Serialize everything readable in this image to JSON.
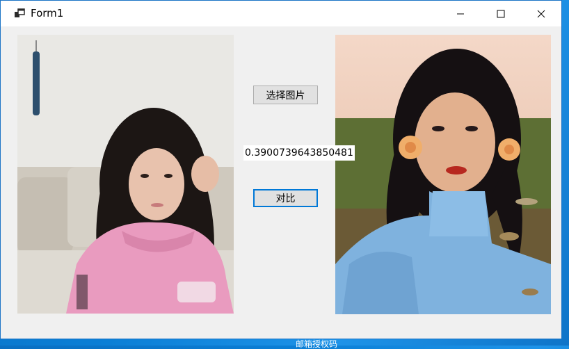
{
  "window": {
    "title": "Form1",
    "icon": "winforms-app-icon",
    "controls": [
      "minimize-icon",
      "maximize-icon",
      "close-icon"
    ]
  },
  "form": {
    "select_image_label": "选择图片",
    "compare_label": "对比",
    "similarity_result": "0.3900739643850481"
  },
  "pictures": {
    "left": "portrait-pink-hoodie",
    "right": "portrait-blue-dress-flowers"
  },
  "taskbar": {
    "partial_text": "邮箱授权码"
  },
  "colors": {
    "accent": "#0078d7",
    "button_face": "#e1e1e1",
    "form_bg": "#f0f0f0"
  }
}
